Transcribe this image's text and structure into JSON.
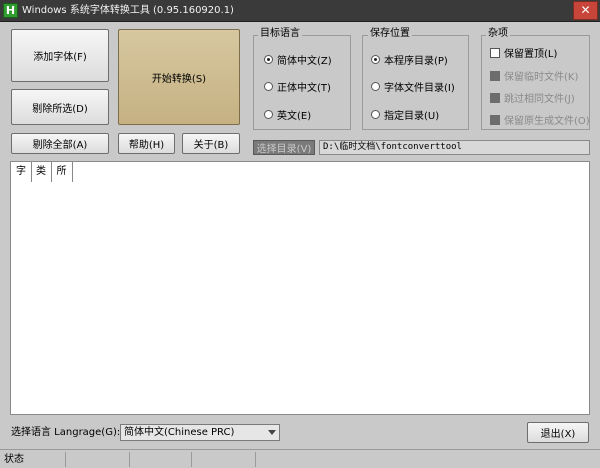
{
  "window": {
    "title": "Windows 系统字体转换工具 (0.95.160920.1)",
    "app_icon_glyph": "H",
    "close_glyph": "✕"
  },
  "buttons": {
    "add_font": "添加字体(F)",
    "remove_selected": "剔除所选(D)",
    "remove_all": "剔除全部(A)",
    "start_convert": "开始转换(S)",
    "help": "帮助(H)",
    "about": "关于(B)",
    "exit": "退出(X)"
  },
  "target_language": {
    "title": "目标语言",
    "options": [
      {
        "label": "简体中文(Z)",
        "selected": true
      },
      {
        "label": "正体中文(T)",
        "selected": false
      },
      {
        "label": "英文(E)",
        "selected": false
      }
    ]
  },
  "save_location": {
    "title": "保存位置",
    "options": [
      {
        "label": "本程序目录(P)",
        "selected": true
      },
      {
        "label": "字体文件目录(I)",
        "selected": false
      },
      {
        "label": "指定目录(U)",
        "selected": false
      }
    ]
  },
  "misc": {
    "title": "杂项",
    "options": [
      {
        "label": "保留置顶(L)",
        "checked": false,
        "enabled": true
      },
      {
        "label": "保留临时文件(K)",
        "checked": false,
        "enabled": false
      },
      {
        "label": "跳过相同文件(J)",
        "checked": false,
        "enabled": false
      },
      {
        "label": "保留原生成文件(O)",
        "checked": false,
        "enabled": false
      }
    ]
  },
  "directory": {
    "select_label": "选择目录(V)",
    "path": "D:\\临时文档\\fontconverttool"
  },
  "list": {
    "columns": [
      "字",
      "类",
      "所"
    ]
  },
  "footer": {
    "language_label": "选择语言 Langrage(G):",
    "language_value": "简体中文(Chinese PRC)"
  },
  "statusbar": {
    "status": "状态"
  },
  "colors": {
    "start_button": "#c9b88c",
    "titlebar": "#3a3a3a",
    "app_icon": "#2f9d2f"
  }
}
